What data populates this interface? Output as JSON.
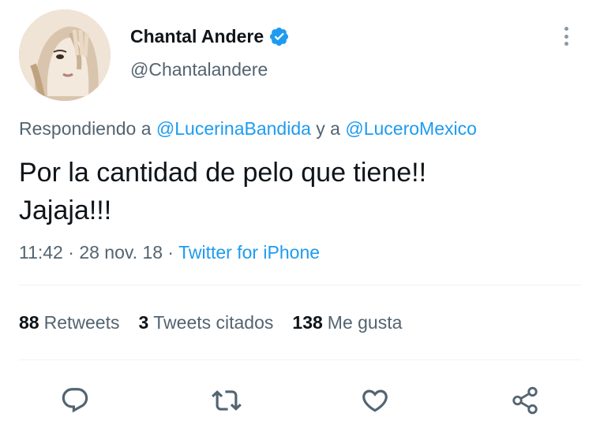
{
  "author": {
    "display_name": "Chantal Andere",
    "handle": "@Chantalandere",
    "verified": true
  },
  "reply": {
    "prefix": "Respondiendo a",
    "mention_1": "@LucerinaBandida",
    "joiner": "y a",
    "mention_2": "@LuceroMexico"
  },
  "tweet": {
    "text_line_1": "Por la cantidad de pelo que tiene!!",
    "text_line_2": "Jajaja!!!",
    "time": "11:42",
    "date": "28 nov. 18",
    "source": "Twitter for iPhone"
  },
  "stats": {
    "retweets_count": "88",
    "retweets_label": "Retweets",
    "quotes_count": "3",
    "quotes_label": "Tweets citados",
    "likes_count": "138",
    "likes_label": "Me gusta"
  },
  "icons": {
    "reply": "reply-icon",
    "retweet": "retweet-icon",
    "like": "heart-icon",
    "share": "share-icon",
    "verified": "verified-badge-icon",
    "more": "more-options-icon"
  },
  "colors": {
    "accent": "#1d9bf0",
    "secondary_text": "#536471",
    "primary_text": "#0f1419",
    "icon_gray": "#536471"
  }
}
